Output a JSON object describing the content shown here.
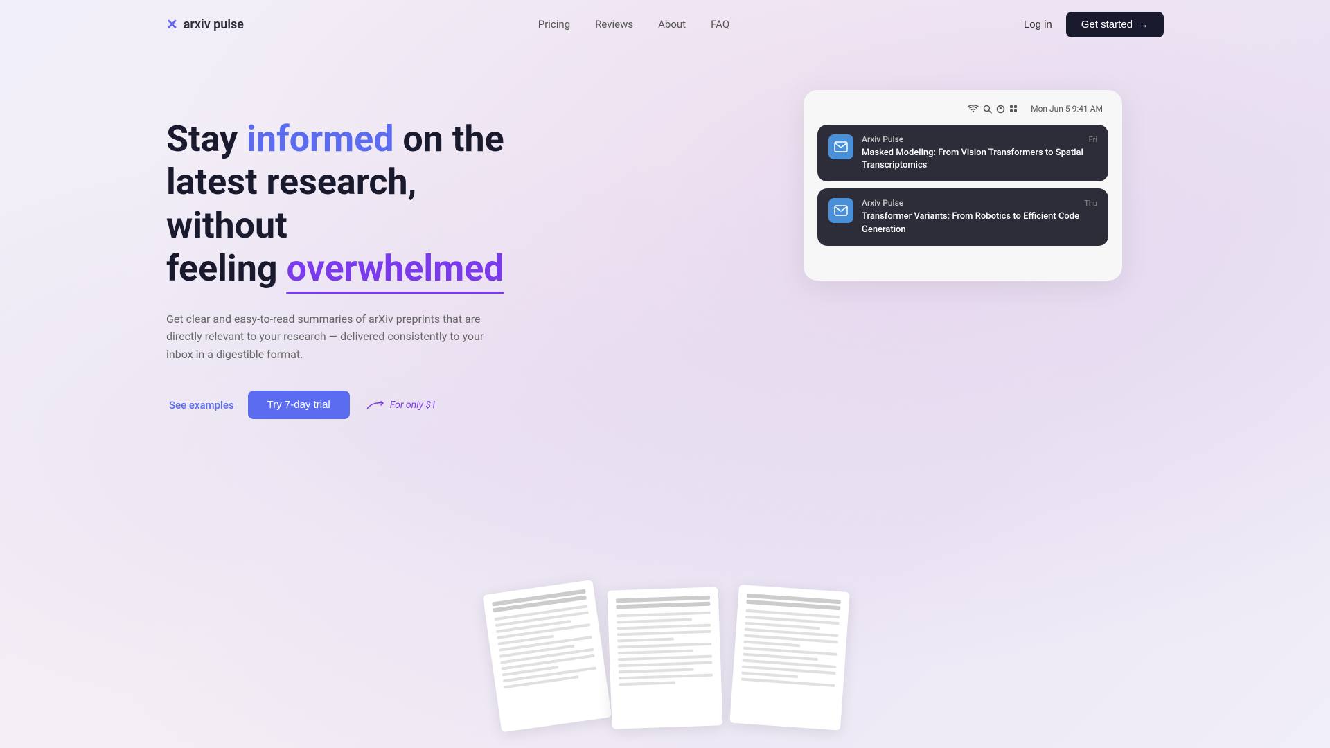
{
  "nav": {
    "logo_text": "arxiv pulse",
    "logo_icon": "✕",
    "links": [
      {
        "label": "Pricing",
        "id": "pricing"
      },
      {
        "label": "Reviews",
        "id": "reviews"
      },
      {
        "label": "About",
        "id": "about"
      },
      {
        "label": "FAQ",
        "id": "faq"
      }
    ],
    "login_label": "Log in",
    "get_started_label": "Get started",
    "arrow": "→"
  },
  "hero": {
    "title_part1": "Stay ",
    "title_highlight1": "informed",
    "title_part2": " on the latest research, without feeling ",
    "title_highlight2": "overwhelmed",
    "description": "Get clear and easy-to-read summaries of arXiv preprints that are directly relevant to your research — delivered consistently to your inbox in a digestible format.",
    "cta_examples": "See examples",
    "cta_trial": "Try 7-day trial",
    "promo_text": "For only $1"
  },
  "phone_mockup": {
    "status_time": "Mon Jun 5  9:41 AM",
    "notifications": [
      {
        "app": "Arxiv Pulse",
        "time": "Fri",
        "title": "Masked Modeling: From Vision Transformers to Spatial Transcriptomics"
      },
      {
        "app": "Arxiv Pulse",
        "time": "Thu",
        "title": "Transformer Variants: From Robotics to Efficient Code Generation"
      }
    ]
  },
  "papers": [
    {
      "id": "paper-1"
    },
    {
      "id": "paper-2"
    },
    {
      "id": "paper-3"
    }
  ],
  "colors": {
    "accent_blue": "#5b6cf0",
    "accent_purple": "#7c3aed",
    "dark": "#1a1a2e",
    "notif_bg": "#2d2d3a",
    "notif_icon_bg": "#4a90d9"
  }
}
